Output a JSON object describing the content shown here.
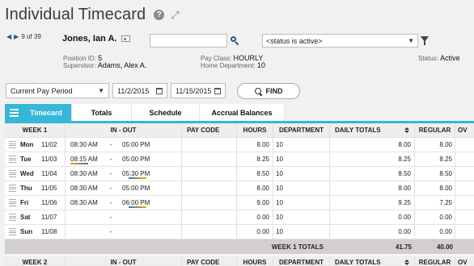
{
  "page": {
    "title": "Individual Timecard"
  },
  "employee": {
    "nav_counter": "9 of 39",
    "name": "Jones, Ian A.",
    "position_id_label": "Position ID:",
    "position_id": "5",
    "supervisor_label": "Supervisor:",
    "supervisor": "Adams, Alex A.",
    "pay_class_label": "Pay Class:",
    "pay_class": "HOURLY",
    "home_dept_label": "Home Department:",
    "home_dept": "10",
    "status_label": "Status:",
    "status": "Active"
  },
  "search": {
    "value": "",
    "status_filter": "<status is active>"
  },
  "filters": {
    "period": "Current Pay Period",
    "start_date": "11/2/2015",
    "end_date": "11/15/2015",
    "find_label": "FIND"
  },
  "tabs": [
    "Timecard",
    "Totals",
    "Schedule",
    "Accrual Balances"
  ],
  "columns": {
    "week1": "WEEK 1",
    "week2": "WEEK 2",
    "in_out": "IN - OUT",
    "pay_code": "PAY CODE",
    "hours": "HOURS",
    "department": "DEPARTMENT",
    "daily_totals": "DAILY TOTALS",
    "regular": "REGULAR",
    "overtime": "OV"
  },
  "week1_rows": [
    {
      "day": "Mon",
      "date": "11/02",
      "in": "08:30 AM",
      "dash": "-",
      "out": "05:00 PM",
      "hours": "8.00",
      "dept": "10",
      "total": "8.00",
      "regular": "8.00"
    },
    {
      "day": "Tue",
      "date": "11/03",
      "in": "08:15 AM",
      "dash": "-",
      "out": "05:00 PM",
      "hours": "8.25",
      "dept": "10",
      "total": "8.25",
      "regular": "8.25"
    },
    {
      "day": "Wed",
      "date": "11/04",
      "in": "08:30 AM",
      "dash": "-",
      "out": "05:30 PM",
      "hours": "8.50",
      "dept": "10",
      "total": "8.50",
      "regular": "8.50"
    },
    {
      "day": "Thu",
      "date": "11/05",
      "in": "08:30 AM",
      "dash": "-",
      "out": "05:00 PM",
      "hours": "8.00",
      "dept": "10",
      "total": "8.00",
      "regular": "8.00"
    },
    {
      "day": "Fri",
      "date": "11/06",
      "in": "08:30 AM",
      "dash": "-",
      "out": "06:00 PM",
      "hours": "9.00",
      "dept": "10",
      "total": "9.25",
      "regular": "7.25"
    },
    {
      "day": "Sat",
      "date": "11/07",
      "in": "",
      "dash": "-",
      "out": "",
      "hours": "0.00",
      "dept": "10",
      "total": "0.00",
      "regular": "0.00"
    },
    {
      "day": "Sun",
      "date": "11/08",
      "in": "",
      "dash": "-",
      "out": "",
      "hours": "0.00",
      "dept": "10",
      "total": "0.00",
      "regular": "0.00"
    }
  ],
  "week1_totals": {
    "label": "WEEK 1 TOTALS",
    "daily_total": "41.75",
    "regular": "40.00"
  }
}
